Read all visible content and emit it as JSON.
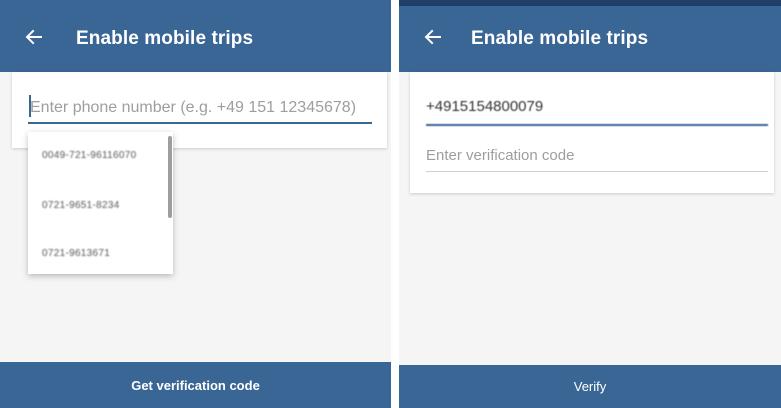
{
  "colors": {
    "primary": "#3a6696",
    "primary_dark": "#1f3f66",
    "background": "#f5f5f5",
    "placeholder": "#9e9e9e"
  },
  "left_screen": {
    "appbar": {
      "title": "Enable mobile trips",
      "back_icon": "arrow-left-icon"
    },
    "phone_input": {
      "value": "",
      "placeholder": "Enter phone number (e.g. +49 151 12345678)"
    },
    "suggestions": [
      "0049-721-96116070",
      "0721-9651-8234",
      "0721-9613671"
    ],
    "action_button": "Get verification code"
  },
  "right_screen": {
    "appbar": {
      "title": "Enable mobile trips",
      "back_icon": "arrow-left-icon"
    },
    "phone_value": "+4915154800079",
    "code_input": {
      "value": "",
      "placeholder": "Enter verification code"
    },
    "action_button": "Verify"
  }
}
